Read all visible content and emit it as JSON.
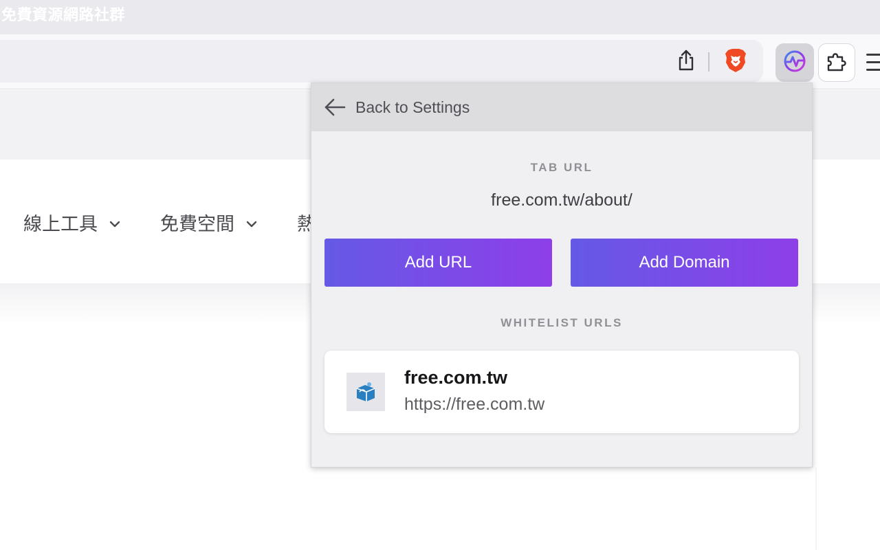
{
  "browser": {
    "tab_title": "免費資源網路社群"
  },
  "toolbar": {
    "icons": [
      "share-icon",
      "brave-shields-icon",
      "extension-pulse-icon",
      "puzzle-icon",
      "hamburger-menu-icon"
    ]
  },
  "site_nav": {
    "items": [
      {
        "label": "線上工具"
      },
      {
        "label": "免費空間"
      },
      {
        "label": "熱"
      }
    ]
  },
  "popup": {
    "back_label": "Back to Settings",
    "tab_url_heading": "TAB URL",
    "tab_url": "free.com.tw/about/",
    "add_url_label": "Add URL",
    "add_domain_label": "Add Domain",
    "whitelist_heading": "WHITELIST URLS",
    "whitelist": [
      {
        "domain": "free.com.tw",
        "url": "https://free.com.tw"
      }
    ]
  },
  "colors": {
    "button_gradient_start": "#6559e6",
    "button_gradient_end": "#8e3fe8",
    "brave_orange": "#f04a24"
  }
}
